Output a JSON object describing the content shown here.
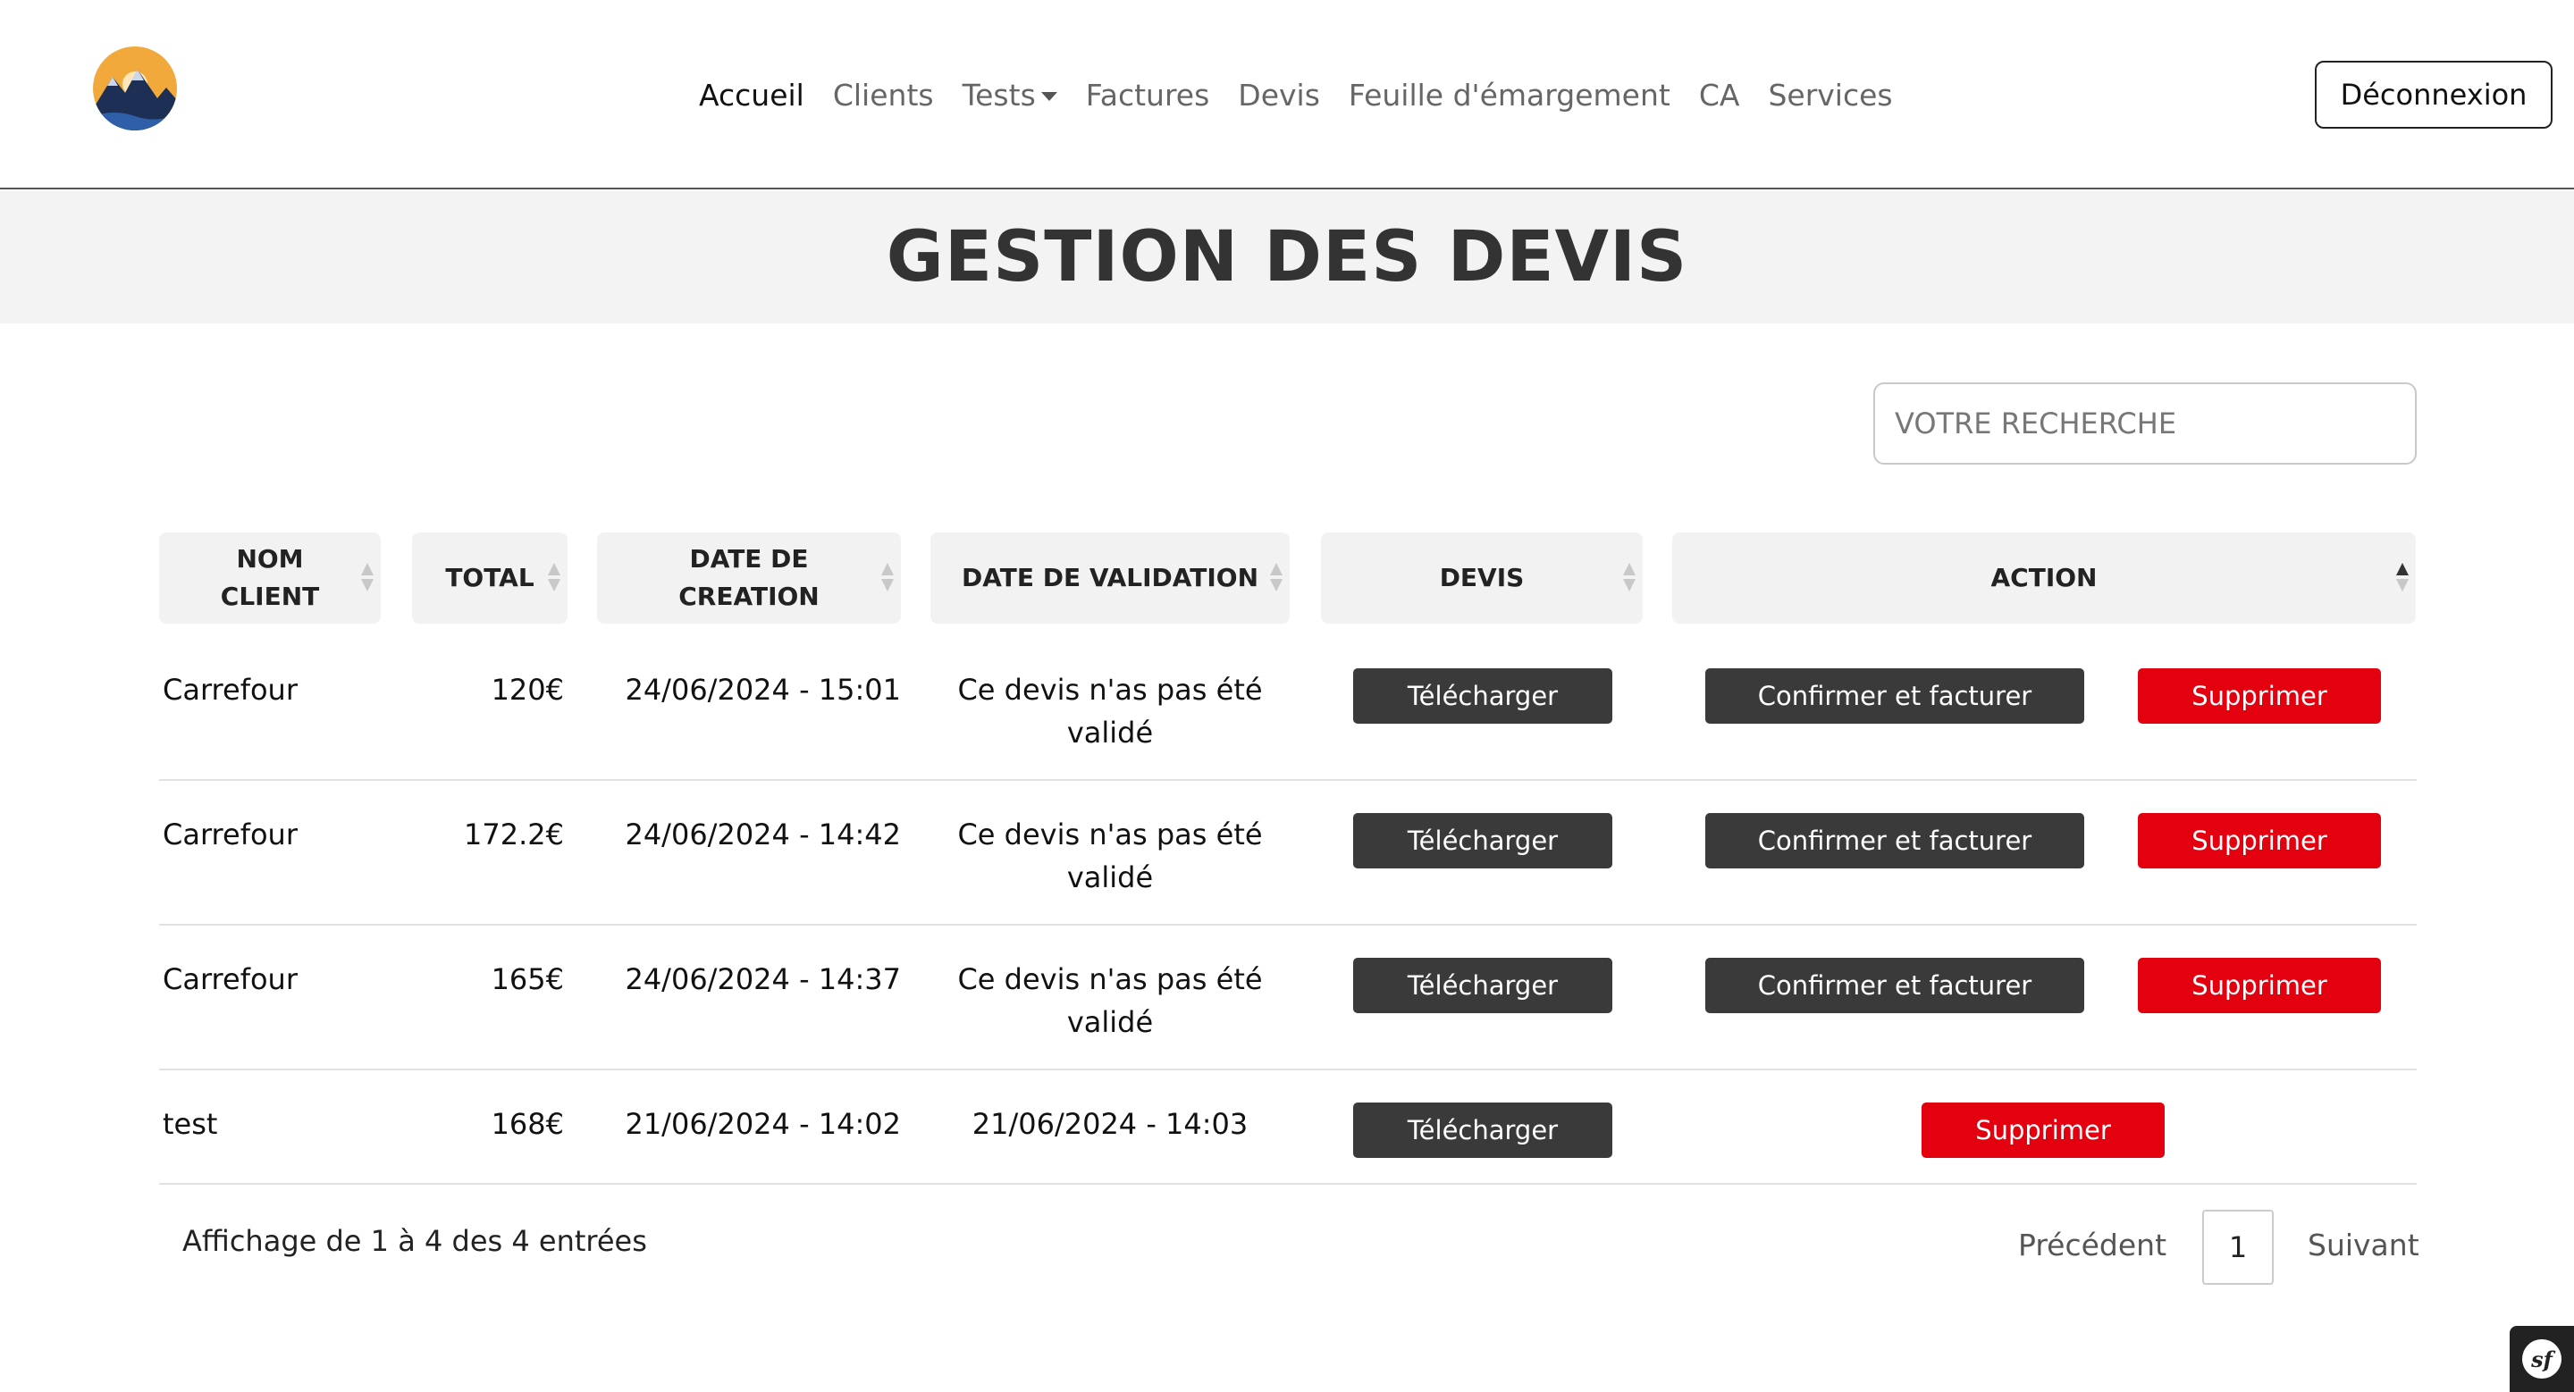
{
  "nav": {
    "links": [
      "Accueil",
      "Clients",
      "Tests",
      "Factures",
      "Devis",
      "Feuille d'émargement",
      "CA",
      "Services"
    ],
    "logout": "Déconnexion"
  },
  "page": {
    "title": "GESTION DES DEVIS"
  },
  "search": {
    "placeholder": "VOTRE RECHERCHE"
  },
  "table": {
    "headers": [
      "NOM CLIENT",
      "TOTAL",
      "DATE DE CREATION",
      "DATE DE VALIDATION",
      "DEVIS",
      "ACTION"
    ],
    "rows": [
      {
        "client": "Carrefour",
        "total": "120€",
        "created": "24/06/2024 - 15:01",
        "validation": "Ce devis n'as pas été validé",
        "download": "Télécharger",
        "confirm": "Confirmer et facturer",
        "delete": "Supprimer"
      },
      {
        "client": "Carrefour",
        "total": "172.2€",
        "created": "24/06/2024 - 14:42",
        "validation": "Ce devis n'as pas été validé",
        "download": "Télécharger",
        "confirm": "Confirmer et facturer",
        "delete": "Supprimer"
      },
      {
        "client": "Carrefour",
        "total": "165€",
        "created": "24/06/2024 - 14:37",
        "validation": "Ce devis n'as pas été validé",
        "download": "Télécharger",
        "confirm": "Confirmer et facturer",
        "delete": "Supprimer"
      },
      {
        "client": "test",
        "total": "168€",
        "created": "21/06/2024 - 14:02",
        "validation": "21/06/2024 - 14:03",
        "download": "Télécharger",
        "delete": "Supprimer"
      }
    ]
  },
  "footer": {
    "info": "Affichage de 1 à 4 des 4 entrées",
    "prev": "Précédent",
    "page": "1",
    "next": "Suivant"
  },
  "colors": {
    "danger": "#e3000f",
    "dark_button": "#3a3a3a",
    "title_band": "#f3f3f3"
  },
  "icons": {
    "logo": "mountain-sunset-logo",
    "dropdown": "caret-down-icon",
    "sort": "sort-arrows-icon",
    "debug": "symfony-icon"
  }
}
